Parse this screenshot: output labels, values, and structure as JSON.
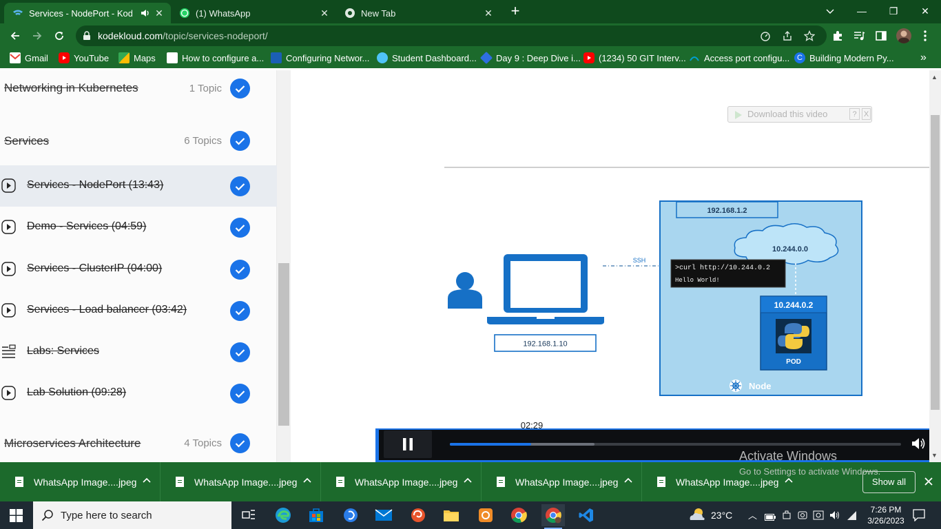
{
  "browser": {
    "tabs": [
      {
        "title": "Services - NodePort - KodeK",
        "active": true
      },
      {
        "title": "(1) WhatsApp",
        "active": false
      },
      {
        "title": "New Tab",
        "active": false
      }
    ],
    "url_host": "kodekloud.com",
    "url_path": "/topic/services-nodeport/",
    "bookmarks": [
      {
        "label": "Gmail",
        "color": "#ea4335"
      },
      {
        "label": "YouTube",
        "color": "#ff0000"
      },
      {
        "label": "Maps",
        "color": "#34a853"
      },
      {
        "label": "How to configure a...",
        "color": "#ffffff"
      },
      {
        "label": "Configuring Networ...",
        "color": "#1b5fb5"
      },
      {
        "label": "Student Dashboard...",
        "color": "#4fc3f7"
      },
      {
        "label": "Day 9 : Deep Dive i...",
        "color": "#2f6fe0"
      },
      {
        "label": "(1234) 50 GIT Interv...",
        "color": "#ff0000"
      },
      {
        "label": "Access port configu...",
        "color": "#00a0d2"
      },
      {
        "label": "Building Modern Py...",
        "color": "#1a73e8"
      }
    ]
  },
  "sidebar": {
    "sections": [
      {
        "title": "Networking in Kubernetes",
        "count": "1 Topic"
      },
      {
        "title": "Services",
        "count": "6 Topics"
      },
      {
        "title": "Microservices Architecture",
        "count": "4 Topics"
      }
    ],
    "lessons": [
      {
        "title": "Services - NodePort (13:43)",
        "kind": "video",
        "active": true
      },
      {
        "title": "Demo - Services (04:59)",
        "kind": "video",
        "active": false
      },
      {
        "title": "Services - ClusterIP (04:00)",
        "kind": "video",
        "active": false
      },
      {
        "title": "Services - Load balancer (03:42)",
        "kind": "video",
        "active": false
      },
      {
        "title": "Labs: Services",
        "kind": "lab",
        "active": false
      },
      {
        "title": "Lab Solution (09:28)",
        "kind": "video",
        "active": false
      }
    ]
  },
  "video": {
    "download_label": "Download this video",
    "help_label": "?",
    "close_label": "X",
    "current_time": "02:29",
    "progress_fraction": 0.18,
    "buffered_fraction": 0.32,
    "slide": {
      "node_ip": "192.168.1.2",
      "pod_network": "10.244.0.0",
      "pod_ip": "10.244.0.2",
      "pod_label": "POD",
      "node_label": "Node",
      "laptop_ip": "192.168.1.10",
      "ssh_label": "SSH",
      "terminal_cmd": ">curl http://10.244.0.2",
      "terminal_out": "Hello World!"
    }
  },
  "downloads": {
    "items": [
      "WhatsApp Image....jpeg",
      "WhatsApp Image....jpeg",
      "WhatsApp Image....jpeg",
      "WhatsApp Image....jpeg",
      "WhatsApp Image....jpeg"
    ],
    "show_all": "Show all"
  },
  "watermark": {
    "title": "Activate Windows",
    "subtitle": "Go to Settings to activate Windows."
  },
  "taskbar": {
    "search_placeholder": "Type here to search",
    "temperature": "23°C",
    "time": "7:26 PM",
    "date": "3/26/2023"
  }
}
